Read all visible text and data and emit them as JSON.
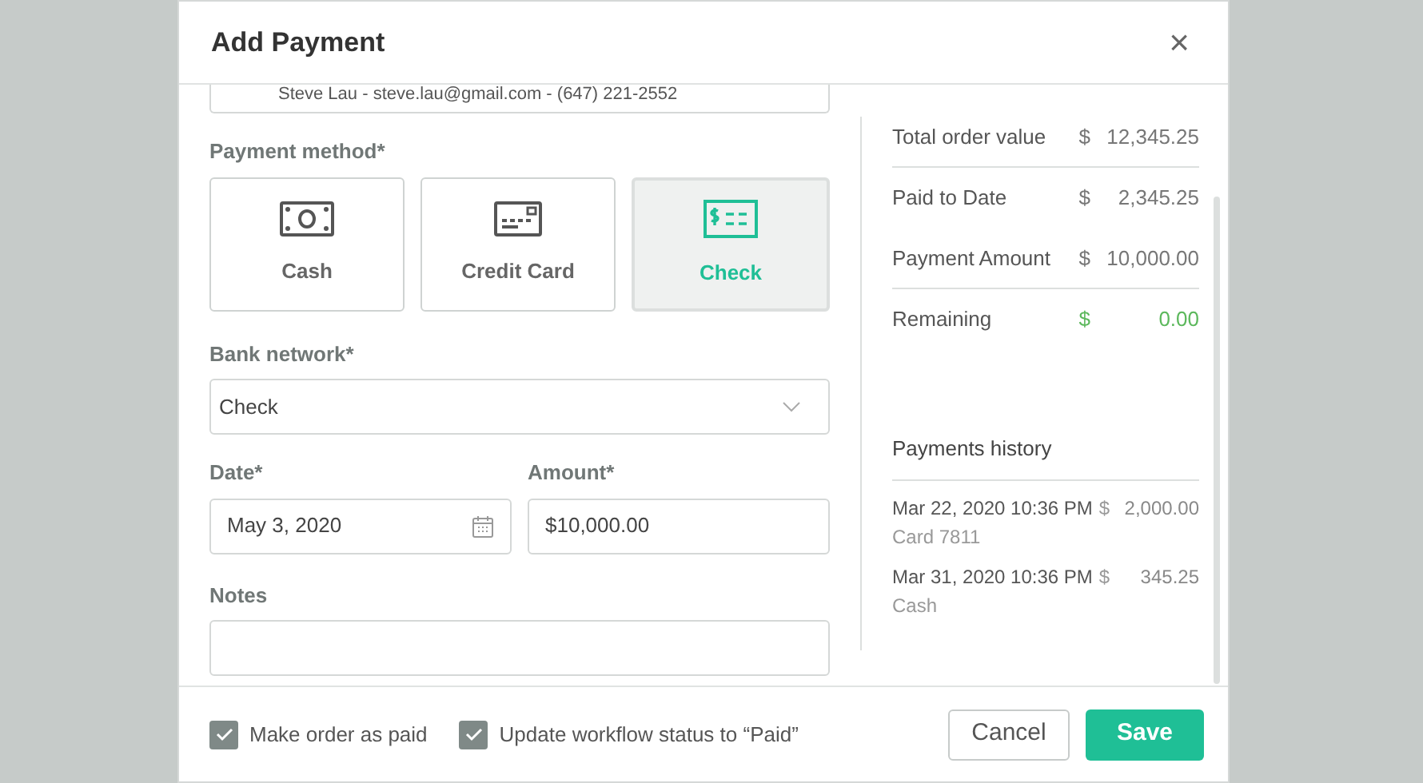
{
  "dialog": {
    "title": "Add Payment",
    "close": "×"
  },
  "contact": {
    "value": "Steve Lau - steve.lau@gmail.com - (647) 221-2552"
  },
  "payment_method": {
    "label": "Payment method*",
    "options": [
      {
        "label": "Cash",
        "kind": "cash",
        "selected": false
      },
      {
        "label": "Credit Card",
        "kind": "card",
        "selected": false
      },
      {
        "label": "Check",
        "kind": "check",
        "selected": true
      }
    ]
  },
  "bank_network": {
    "label": "Bank network*",
    "value": "Check"
  },
  "date": {
    "label": "Date*",
    "value": "May 3, 2020"
  },
  "amount": {
    "label": "Amount*",
    "value": "$10,000.00"
  },
  "notes": {
    "label": "Notes"
  },
  "summary": [
    {
      "label": "Total order value",
      "currency": "$",
      "value": "12,345.25",
      "highlight": false,
      "divider_after": true
    },
    {
      "label": "Paid to Date",
      "currency": "$",
      "value": "2,345.25",
      "highlight": false,
      "divider_after": false
    },
    {
      "label": "Payment Amount",
      "currency": "$",
      "value": "10,000.00",
      "highlight": false,
      "divider_after": true
    },
    {
      "label": "Remaining",
      "currency": "$",
      "value": "0.00",
      "highlight": true,
      "divider_after": false
    }
  ],
  "history": {
    "title": "Payments history",
    "items": [
      {
        "date": "Mar 22, 2020 10:36 PM",
        "method": "Card 7811",
        "currency": "$",
        "value": "2,000.00"
      },
      {
        "date": "Mar 31, 2020 10:36 PM",
        "method": "Cash",
        "currency": "$",
        "value": "345.25"
      }
    ]
  },
  "footer": {
    "options": [
      {
        "label": "Make order as paid",
        "checked": true
      },
      {
        "label": "Update workflow status to “Paid”",
        "checked": true
      }
    ],
    "cancel": "Cancel",
    "save": "Save"
  }
}
